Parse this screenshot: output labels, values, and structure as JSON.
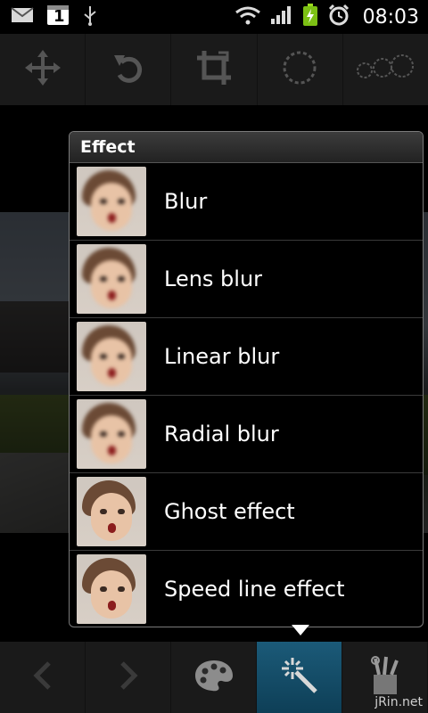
{
  "status_bar": {
    "time": "08:03",
    "icons": [
      "gmail-icon",
      "calendar-icon",
      "usb-icon",
      "wifi-icon",
      "signal-icon",
      "battery-charging-icon",
      "alarm-icon"
    ],
    "calendar_day": "1"
  },
  "top_toolbar": {
    "tools": [
      "move-icon",
      "rotate-icon",
      "crop-icon",
      "circle-select-icon",
      "multi-circle-icon"
    ]
  },
  "popup": {
    "title": "Effect",
    "items": [
      {
        "label": "Blur"
      },
      {
        "label": "Lens blur"
      },
      {
        "label": "Linear blur"
      },
      {
        "label": "Radial blur"
      },
      {
        "label": "Ghost effect"
      },
      {
        "label": "Speed line effect"
      }
    ]
  },
  "bottom_toolbar": {
    "tools": [
      "back-arrow-icon",
      "forward-arrow-icon",
      "palette-icon",
      "effect-wand-icon",
      "tools-icon"
    ],
    "active": "effect-wand-icon"
  },
  "watermark": "jRin.net",
  "colors": {
    "accent": "#1b5a78",
    "popup_border": "#7a7a7a"
  }
}
